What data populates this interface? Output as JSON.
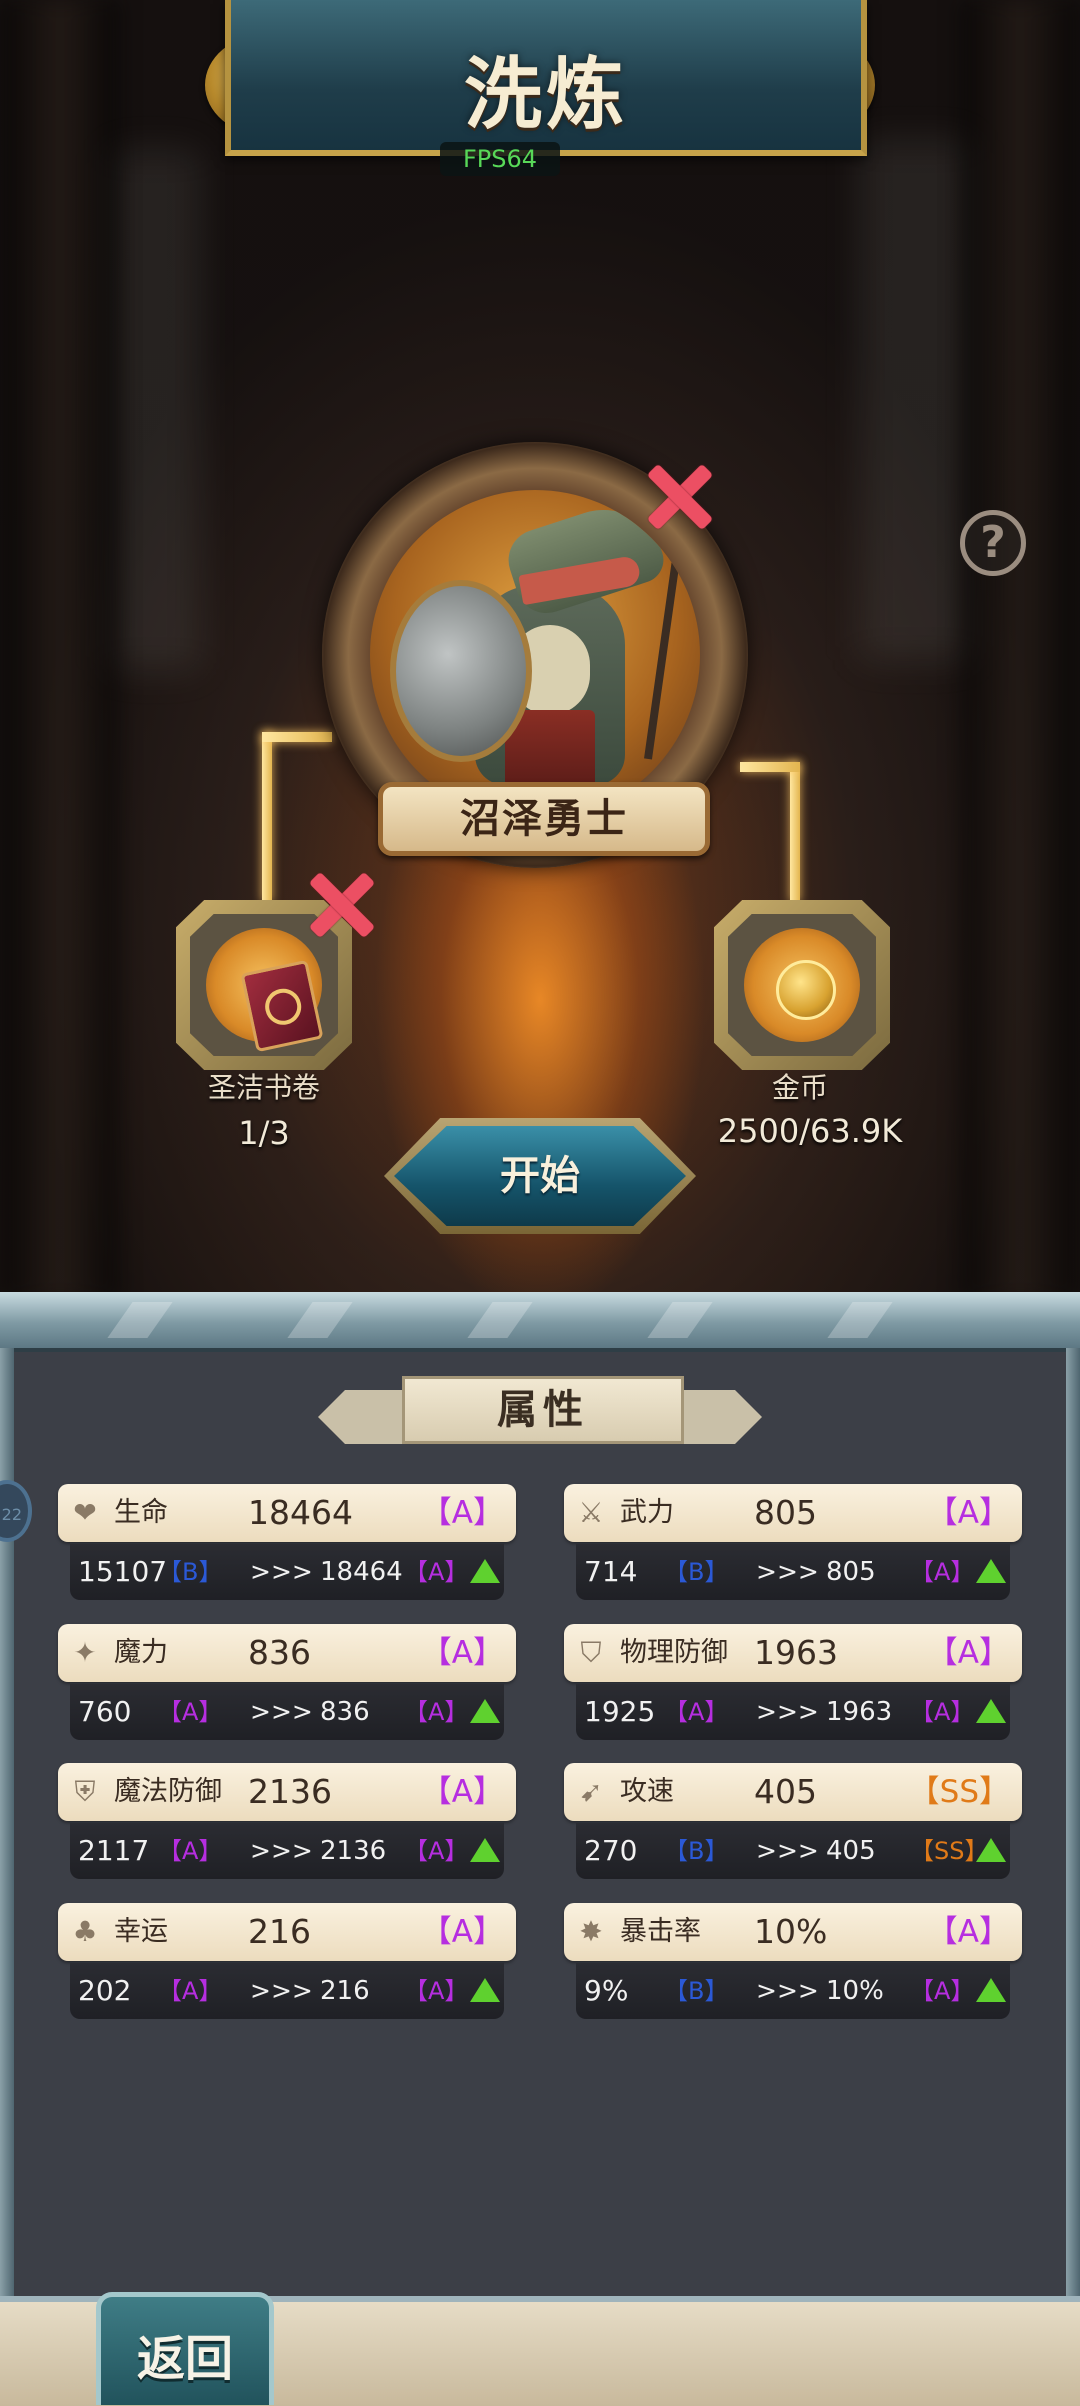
{
  "header": {
    "title": "洗炼",
    "fps": "FPS64"
  },
  "hero": {
    "name": "沼泽勇士"
  },
  "help": {
    "icon": "question-icon",
    "glyph": "?"
  },
  "slots": {
    "left": {
      "label": "圣洁书卷",
      "value": "1/3",
      "icon": "scroll-book-icon"
    },
    "right": {
      "label": "金币",
      "value": "2500/63.9K",
      "icon": "gold-coin-icon"
    }
  },
  "start_button": {
    "label": "开始"
  },
  "attributes_panel": {
    "title": "属性",
    "side_badge": "22",
    "items": [
      {
        "name": "生命",
        "icon": "heart-icon",
        "value": "18464",
        "grade": "【A】",
        "grade_class": "A",
        "old": "15107",
        "old_grade": "【B】",
        "old_grade_class": "B",
        "arrow": ">>>",
        "new": "18464",
        "new_grade": "【A】",
        "new_grade_class": "A"
      },
      {
        "name": "武力",
        "icon": "sword-icon",
        "value": "805",
        "grade": "【A】",
        "grade_class": "A",
        "old": "714",
        "old_grade": "【B】",
        "old_grade_class": "B",
        "arrow": ">>>",
        "new": "805",
        "new_grade": "【A】",
        "new_grade_class": "A"
      },
      {
        "name": "魔力",
        "icon": "magic-sparkle-icon",
        "value": "836",
        "grade": "【A】",
        "grade_class": "A",
        "old": "760",
        "old_grade": "【A】",
        "old_grade_class": "A",
        "arrow": ">>>",
        "new": "836",
        "new_grade": "【A】",
        "new_grade_class": "A"
      },
      {
        "name": "物理防御",
        "icon": "shield-icon",
        "value": "1963",
        "grade": "【A】",
        "grade_class": "A",
        "old": "1925",
        "old_grade": "【A】",
        "old_grade_class": "A",
        "arrow": ">>>",
        "new": "1963",
        "new_grade": "【A】",
        "new_grade_class": "A"
      },
      {
        "name": "魔法防御",
        "icon": "magic-shield-icon",
        "value": "2136",
        "grade": "【A】",
        "grade_class": "A",
        "old": "2117",
        "old_grade": "【A】",
        "old_grade_class": "A",
        "arrow": ">>>",
        "new": "2136",
        "new_grade": "【A】",
        "new_grade_class": "A"
      },
      {
        "name": "攻速",
        "icon": "attack-speed-icon",
        "value": "405",
        "grade": "【SS】",
        "grade_class": "SS",
        "old": "270",
        "old_grade": "【B】",
        "old_grade_class": "B",
        "arrow": ">>>",
        "new": "405",
        "new_grade": "【SS】",
        "new_grade_class": "SS"
      },
      {
        "name": "幸运",
        "icon": "clover-icon",
        "value": "216",
        "grade": "【A】",
        "grade_class": "A",
        "old": "202",
        "old_grade": "【A】",
        "old_grade_class": "A",
        "arrow": ">>>",
        "new": "216",
        "new_grade": "【A】",
        "new_grade_class": "A"
      },
      {
        "name": "暴击率",
        "icon": "critical-burst-icon",
        "value": "10%",
        "grade": "【A】",
        "grade_class": "A",
        "old": "9%",
        "old_grade": "【B】",
        "old_grade_class": "B",
        "arrow": ">>>",
        "new": "10%",
        "new_grade": "【A】",
        "new_grade_class": "A"
      }
    ]
  },
  "footer": {
    "back_label": "返回"
  }
}
